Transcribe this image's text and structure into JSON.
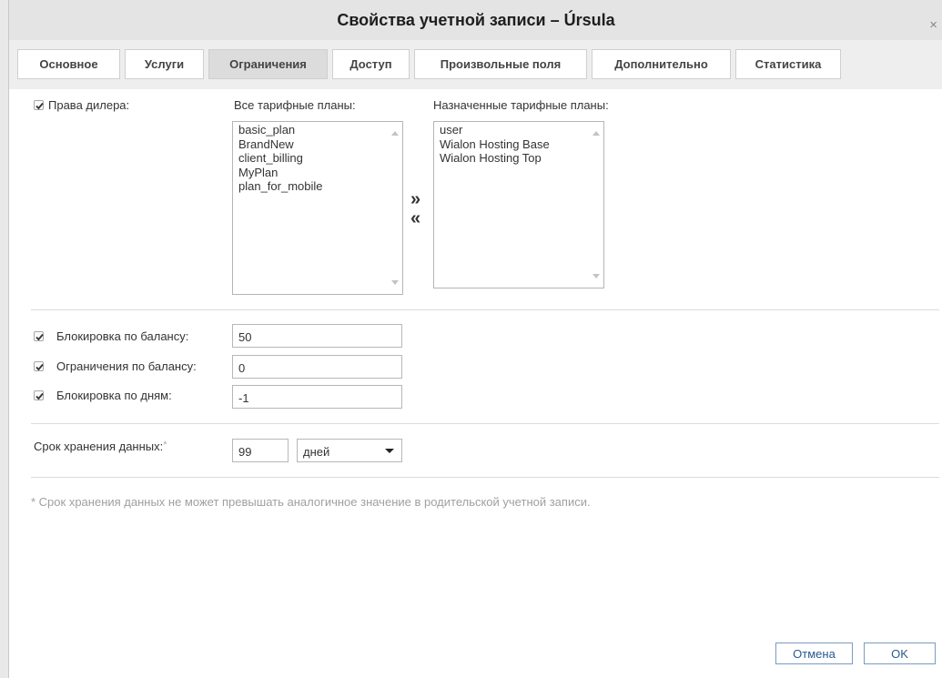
{
  "window": {
    "title": "Свойства учетной записи – Úrsula",
    "close_glyph": "×"
  },
  "tabs": [
    {
      "label": "Основное"
    },
    {
      "label": "Услуги"
    },
    {
      "label": "Ограничения"
    },
    {
      "label": "Доступ"
    },
    {
      "label": "Произвольные поля"
    },
    {
      "label": "Дополнительно"
    },
    {
      "label": "Статистика"
    }
  ],
  "active_tab": "Ограничения",
  "dealer": {
    "label": "Права дилера:",
    "checked": true
  },
  "all_plans": {
    "header": "Все тарифные планы:",
    "items": [
      "basic_plan",
      "BrandNew",
      "client_billing",
      "MyPlan",
      "plan_for_mobile"
    ]
  },
  "assigned_plans": {
    "header": "Назначенные тарифные планы:",
    "items": [
      "user",
      "Wialon Hosting Base",
      "Wialon Hosting Top"
    ]
  },
  "move_buttons": {
    "add": "»",
    "remove": "«"
  },
  "limits": [
    {
      "label": "Блокировка по балансу:",
      "value": "50",
      "checked": true
    },
    {
      "label": "Ограничения по балансу:",
      "value": "0",
      "checked": true
    },
    {
      "label": "Блокировка по дням:",
      "value": "-1",
      "checked": true
    }
  ],
  "retention": {
    "label": "Срок хранения данных:",
    "required_mark": "*",
    "value": "99",
    "unit": "дней"
  },
  "footnote": "* Срок хранения данных не может превышать аналогичное значение в родительской учетной записи.",
  "buttons": {
    "cancel": "Отмена",
    "ok": "OK"
  },
  "colors": {
    "titlebar_bg": "#e4e4e4",
    "active_tab_bg": "#dcdcdc",
    "button_text": "#2a5a8e"
  }
}
